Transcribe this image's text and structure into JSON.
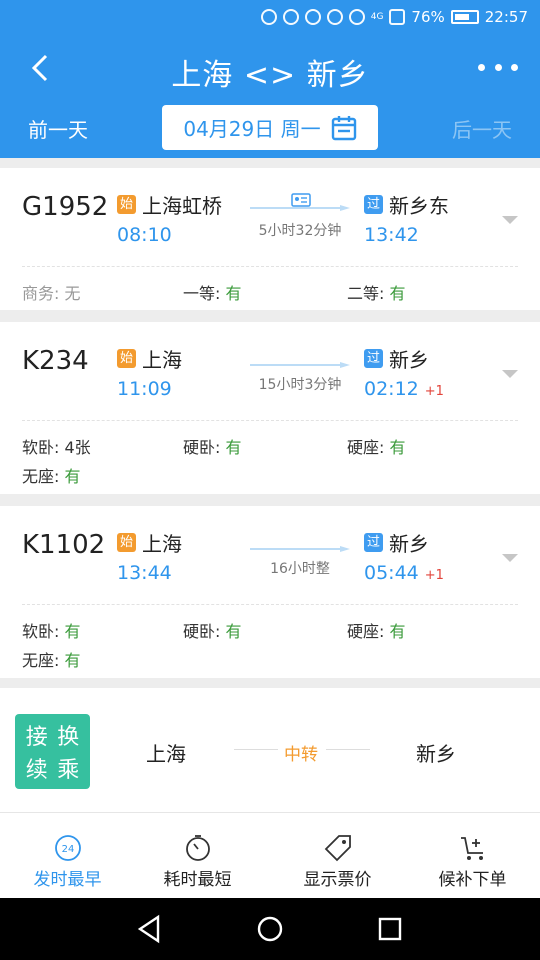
{
  "status_bar": {
    "battery": "76%",
    "time": "22:57",
    "network": "4G"
  },
  "header": {
    "title": "上海 <> 新乡",
    "prev_day": "前一天",
    "date": "04月29日 周一",
    "next_day": "后一天"
  },
  "trains": [
    {
      "number": "G1952",
      "from_tag": "始",
      "from": "上海虹桥",
      "depart": "08:10",
      "duration": "5小时32分钟",
      "to_tag": "过",
      "to": "新乡东",
      "arrive": "13:42",
      "arrive_plus": "",
      "seats": [
        {
          "label": "商务: ",
          "value": "无"
        },
        {
          "label": "一等: ",
          "value": "有"
        },
        {
          "label": "二等: ",
          "value": "有"
        }
      ]
    },
    {
      "number": "K234",
      "from_tag": "始",
      "from": "上海",
      "depart": "11:09",
      "duration": "15小时3分钟",
      "to_tag": "过",
      "to": "新乡",
      "arrive": "02:12",
      "arrive_plus": "+1",
      "seats": [
        {
          "label": "软卧: ",
          "value": "4张"
        },
        {
          "label": "硬卧: ",
          "value": "有"
        },
        {
          "label": "硬座: ",
          "value": "有"
        },
        {
          "label": "无座: ",
          "value": "有"
        }
      ]
    },
    {
      "number": "K1102",
      "from_tag": "始",
      "from": "上海",
      "depart": "13:44",
      "duration": "16小时整",
      "to_tag": "过",
      "to": "新乡",
      "arrive": "05:44",
      "arrive_plus": "+1",
      "seats": [
        {
          "label": "软卧: ",
          "value": "有"
        },
        {
          "label": "硬卧: ",
          "value": "有"
        },
        {
          "label": "硬座: ",
          "value": "有"
        },
        {
          "label": "无座: ",
          "value": "有"
        }
      ]
    }
  ],
  "transfer": {
    "badge": [
      "接",
      "换",
      "续",
      "乘"
    ],
    "from": "上海",
    "middle": "中转",
    "to": "新乡"
  },
  "tabs": [
    {
      "label": "发时最早",
      "icon": "clock-24-icon",
      "badge": "24"
    },
    {
      "label": "耗时最短",
      "icon": "timer-icon"
    },
    {
      "label": "显示票价",
      "icon": "price-tag-icon"
    },
    {
      "label": "候补下单",
      "icon": "cart-add-icon"
    }
  ],
  "colors": {
    "primary": "#2f95ec",
    "start_tag": "#f39b2f",
    "pass_tag": "#3f9cf0",
    "available": "#3a9a3a",
    "next_day": "#e2443b",
    "transfer_badge": "#36c09f"
  }
}
